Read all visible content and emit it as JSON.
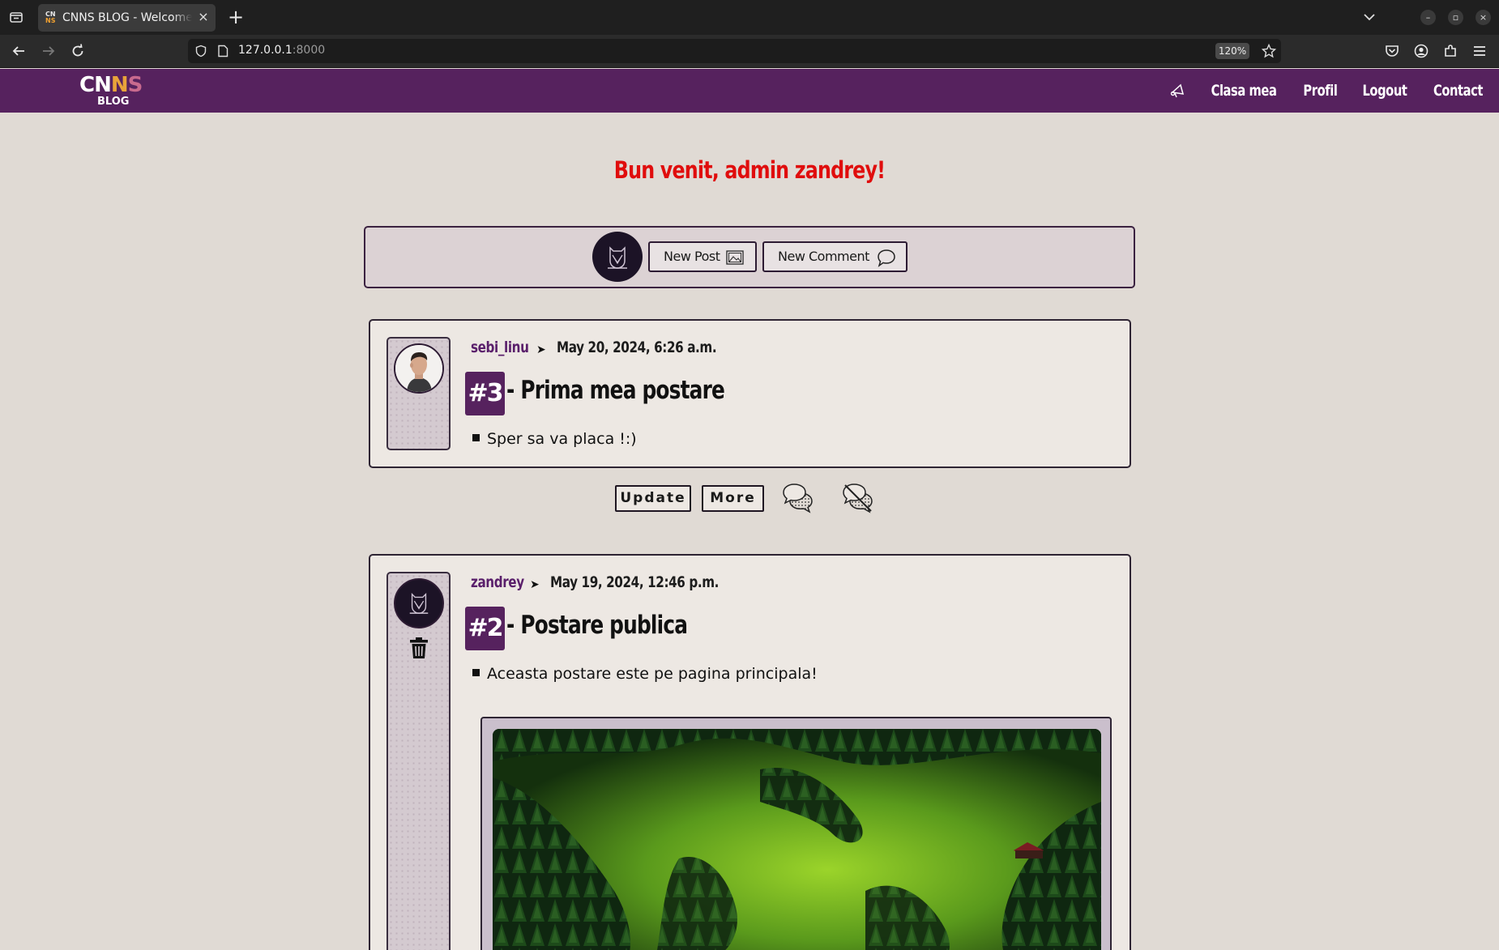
{
  "browser": {
    "tab_title": "CNNS BLOG - Welcome, zandrey",
    "url_host": "127.0.0.1",
    "url_port": ":8000",
    "zoom": "120%"
  },
  "site": {
    "logo_text": "CNNS",
    "logo_sub": "BLOG",
    "brand_color": "#56225e",
    "nav": [
      "Clasa mea",
      "Profil",
      "Logout",
      "Contact"
    ]
  },
  "welcome": "Bun venit, admin zandrey!",
  "actions": {
    "new_post": "New Post",
    "new_comment": "New Comment"
  },
  "posts": [
    {
      "author": "sebi_linu",
      "date": "May 20, 2024, 6:26 a.m.",
      "number": "#3",
      "title": "- Prima mea postare",
      "body": "Sper sa va placa !:)"
    },
    {
      "author": "zandrey",
      "date": "May 19, 2024, 12:46 p.m.",
      "number": "#2",
      "title": "- Postare publica",
      "body": "Aceasta postare este pe pagina principala!"
    }
  ],
  "post_buttons": {
    "update": "Update",
    "more": "More"
  },
  "icons": {
    "owl": "owl-icon",
    "image": "image-icon",
    "comment": "speech-bubble-icon",
    "comments": "chat-bubbles-icon",
    "hide_comments": "chat-bubbles-off-icon",
    "trash": "trash-icon",
    "announce": "megaphone-icon"
  }
}
